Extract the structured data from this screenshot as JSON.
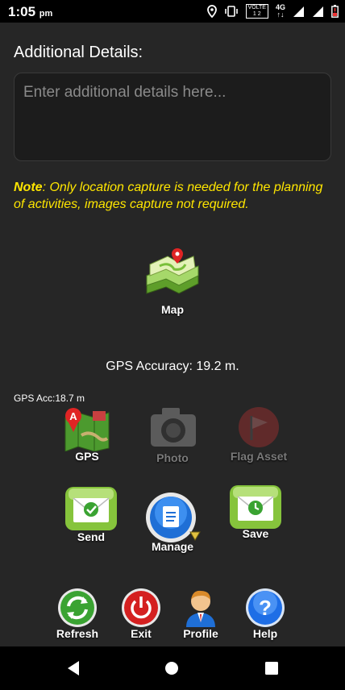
{
  "status_bar": {
    "time": "1:05",
    "period": "pm",
    "volte_line1": "VOLTE",
    "volte_line2": "1 2",
    "network": "4G"
  },
  "form": {
    "details_label": "Additional Details:",
    "details_placeholder": "Enter additional details here...",
    "details_value": ""
  },
  "note": {
    "prefix": "Note",
    "text": ": Only location capture is needed for the planning of activities, images capture not required."
  },
  "map_button": {
    "label": "Map"
  },
  "gps": {
    "accuracy_text": "GPS Accuracy: 19.2 m.",
    "small_text": "GPS Acc:18.7 m"
  },
  "actions": {
    "gps": "GPS",
    "photo": "Photo",
    "flag_asset": "Flag Asset",
    "send": "Send",
    "manage": "Manage",
    "save": "Save",
    "refresh": "Refresh",
    "exit": "Exit",
    "profile": "Profile",
    "help": "Help"
  },
  "colors": {
    "background": "#262626",
    "note_yellow": "#ffe600",
    "green": "#7ac142",
    "red": "#d42020",
    "blue": "#1e6ee6"
  }
}
